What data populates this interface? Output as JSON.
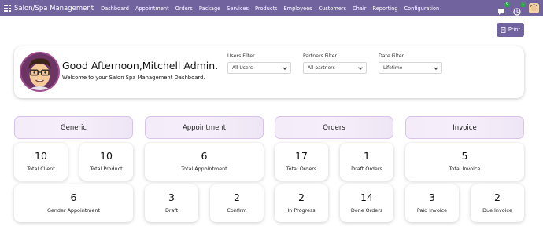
{
  "navbar": {
    "brand": "Salon/Spa Management",
    "menu": [
      "Dashboard",
      "Appointment",
      "Orders",
      "Package",
      "Services",
      "Products",
      "Employees",
      "Customers",
      "Chair",
      "Reporting",
      "Configuration"
    ],
    "chat_badge": "6",
    "activity_badge": "1"
  },
  "print_label": "Print",
  "welcome": {
    "greeting": "Good Afternoon,Mitchell Admin.",
    "subtitle": "Welcome to your Salon Spa Management Dashboard."
  },
  "filters": {
    "users": {
      "label": "Users Filter",
      "value": "All Users"
    },
    "partners": {
      "label": "Partners Filter",
      "value": "All partners"
    },
    "date": {
      "label": "Date Filter",
      "value": "Lifetime"
    }
  },
  "sections": {
    "generic": {
      "title": "Generic",
      "total_client": {
        "value": "10",
        "label": "Total Client"
      },
      "total_product": {
        "value": "10",
        "label": "Total Product"
      },
      "gender_appointment": {
        "value": "6",
        "label": "Gender Appointment"
      }
    },
    "appointment": {
      "title": "Appointment",
      "total_appointment": {
        "value": "6",
        "label": "Total Appointment"
      },
      "draft": {
        "value": "3",
        "label": "Draft"
      },
      "confirm": {
        "value": "2",
        "label": "Confirm"
      }
    },
    "orders": {
      "title": "Orders",
      "total_orders": {
        "value": "17",
        "label": "Total Orders"
      },
      "draft_orders": {
        "value": "1",
        "label": "Draft Orders"
      },
      "in_progress": {
        "value": "2",
        "label": "In Progress"
      },
      "done_orders": {
        "value": "14",
        "label": "Done Orders"
      }
    },
    "invoice": {
      "title": "Invoice",
      "total_invoice": {
        "value": "5",
        "label": "Total Invoice"
      },
      "paid_invoice": {
        "value": "3",
        "label": "Paid Invoice"
      },
      "due_invoice": {
        "value": "2",
        "label": "Due Invoice"
      }
    }
  },
  "colors": {
    "brand": "#71639e",
    "section_border": "#d8c3ea",
    "badge": "#28a745"
  },
  "icons": [
    "apps-icon",
    "chat-icon",
    "clock-icon",
    "print-icon",
    "chevron-down-icon"
  ]
}
